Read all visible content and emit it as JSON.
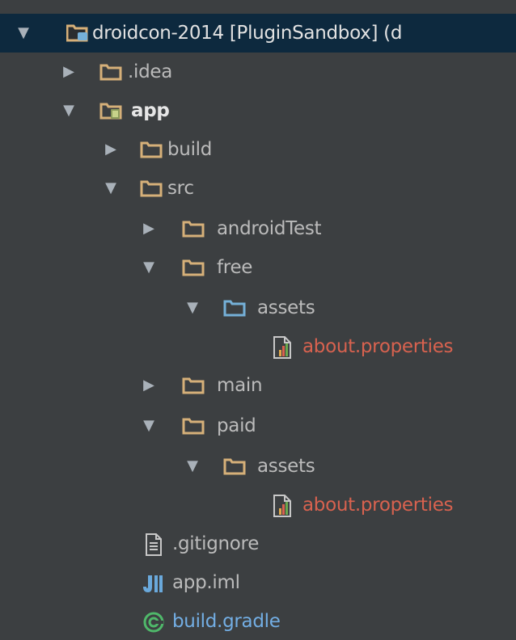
{
  "tree": {
    "root": {
      "label": "droidcon-2014 [PluginSandbox] (d"
    },
    "idea": {
      "label": ".idea"
    },
    "app": {
      "label": "app"
    },
    "build": {
      "label": "build"
    },
    "src": {
      "label": "src"
    },
    "androidTest": {
      "label": "androidTest"
    },
    "free": {
      "label": "free"
    },
    "free_assets": {
      "label": "assets"
    },
    "free_about": {
      "label": "about.properties"
    },
    "main": {
      "label": "main"
    },
    "paid": {
      "label": "paid"
    },
    "paid_assets": {
      "label": "assets"
    },
    "paid_about": {
      "label": "about.properties"
    },
    "gitignore": {
      "label": ".gitignore"
    },
    "app_iml": {
      "label": "app.iml"
    },
    "build_gradle": {
      "label": "build.gradle"
    }
  },
  "colors": {
    "background": "#3c3f41",
    "selection": "#0d293e",
    "folder": "#d6b079",
    "resource_folder": "#75b0d8",
    "modified_file": "#d8624f",
    "gradle_file": "#73aee4"
  },
  "icons": {
    "collapse": "triangle-down-icon",
    "expand": "triangle-right-icon",
    "folder": "folder-icon",
    "module": "module-folder-icon",
    "properties": "properties-file-icon",
    "text": "text-file-icon",
    "iml": "iml-file-icon",
    "gradle": "gradle-file-icon"
  }
}
